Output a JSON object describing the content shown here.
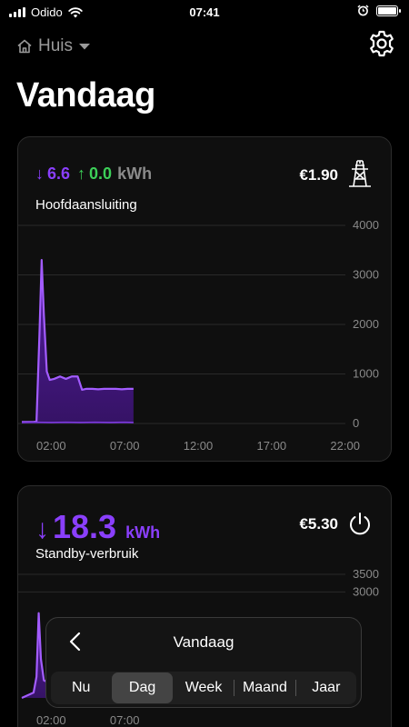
{
  "status_bar": {
    "carrier": "Odido",
    "time": "07:41"
  },
  "header": {
    "home_label": "Huis",
    "title": "Vandaag"
  },
  "card1": {
    "import_value": "6.6",
    "export_value": "0.0",
    "unit": "kWh",
    "cost": "€1.90",
    "subtitle": "Hoofdaansluiting",
    "icon": "power-pylon-icon"
  },
  "card2": {
    "value": "18.3",
    "unit": "kWh",
    "cost": "€5.30",
    "subtitle": "Standby-verbruik",
    "icon": "power-icon"
  },
  "picker": {
    "title": "Vandaag",
    "options": [
      "Nu",
      "Dag",
      "Week",
      "Maand",
      "Jaar"
    ],
    "selected": "Dag"
  },
  "colors": {
    "accent": "#8a3ffc",
    "export": "#3ccf58",
    "fill": "#3a136f",
    "card_bg": "#0f0f0f"
  },
  "chart_data": [
    {
      "type": "area",
      "x_labels": [
        "02:00",
        "07:00",
        "12:00",
        "17:00",
        "22:00"
      ],
      "y_ticks": [
        0,
        1000,
        2000,
        3000,
        4000
      ],
      "ylim": [
        0,
        4000
      ],
      "xlim": [
        0,
        24
      ],
      "series": [
        {
          "x": [
            0,
            0.4,
            0.8,
            1.0,
            1.2,
            1.35,
            1.5,
            1.7,
            1.9,
            2.2,
            2.6,
            3.0,
            3.4,
            3.8,
            4.1,
            4.4,
            4.8,
            5.2,
            5.6,
            6.0,
            6.4,
            6.8,
            7.2,
            7.6
          ],
          "y": [
            30,
            30,
            30,
            40,
            1800,
            3300,
            2200,
            1050,
            880,
            900,
            950,
            900,
            950,
            950,
            680,
            700,
            700,
            690,
            700,
            700,
            700,
            690,
            700,
            700
          ]
        },
        {
          "x": [
            0,
            1.0,
            2.0,
            3.0,
            4.0,
            5.0,
            6.0,
            7.0,
            7.6
          ],
          "y": [
            20,
            25,
            20,
            25,
            20,
            25,
            20,
            25,
            20
          ]
        }
      ]
    },
    {
      "type": "area",
      "x_labels": [
        "02:00",
        "07:00"
      ],
      "y_ticks": [
        3000,
        3500
      ],
      "ylim": [
        0,
        3500
      ],
      "xlim": [
        0,
        24
      ],
      "series": [
        {
          "x": [
            0,
            0.8,
            1.0,
            1.15,
            1.3,
            1.5,
            2.0,
            2.4
          ],
          "y": [
            0,
            150,
            600,
            2400,
            1100,
            500,
            400,
            350
          ]
        }
      ]
    }
  ]
}
